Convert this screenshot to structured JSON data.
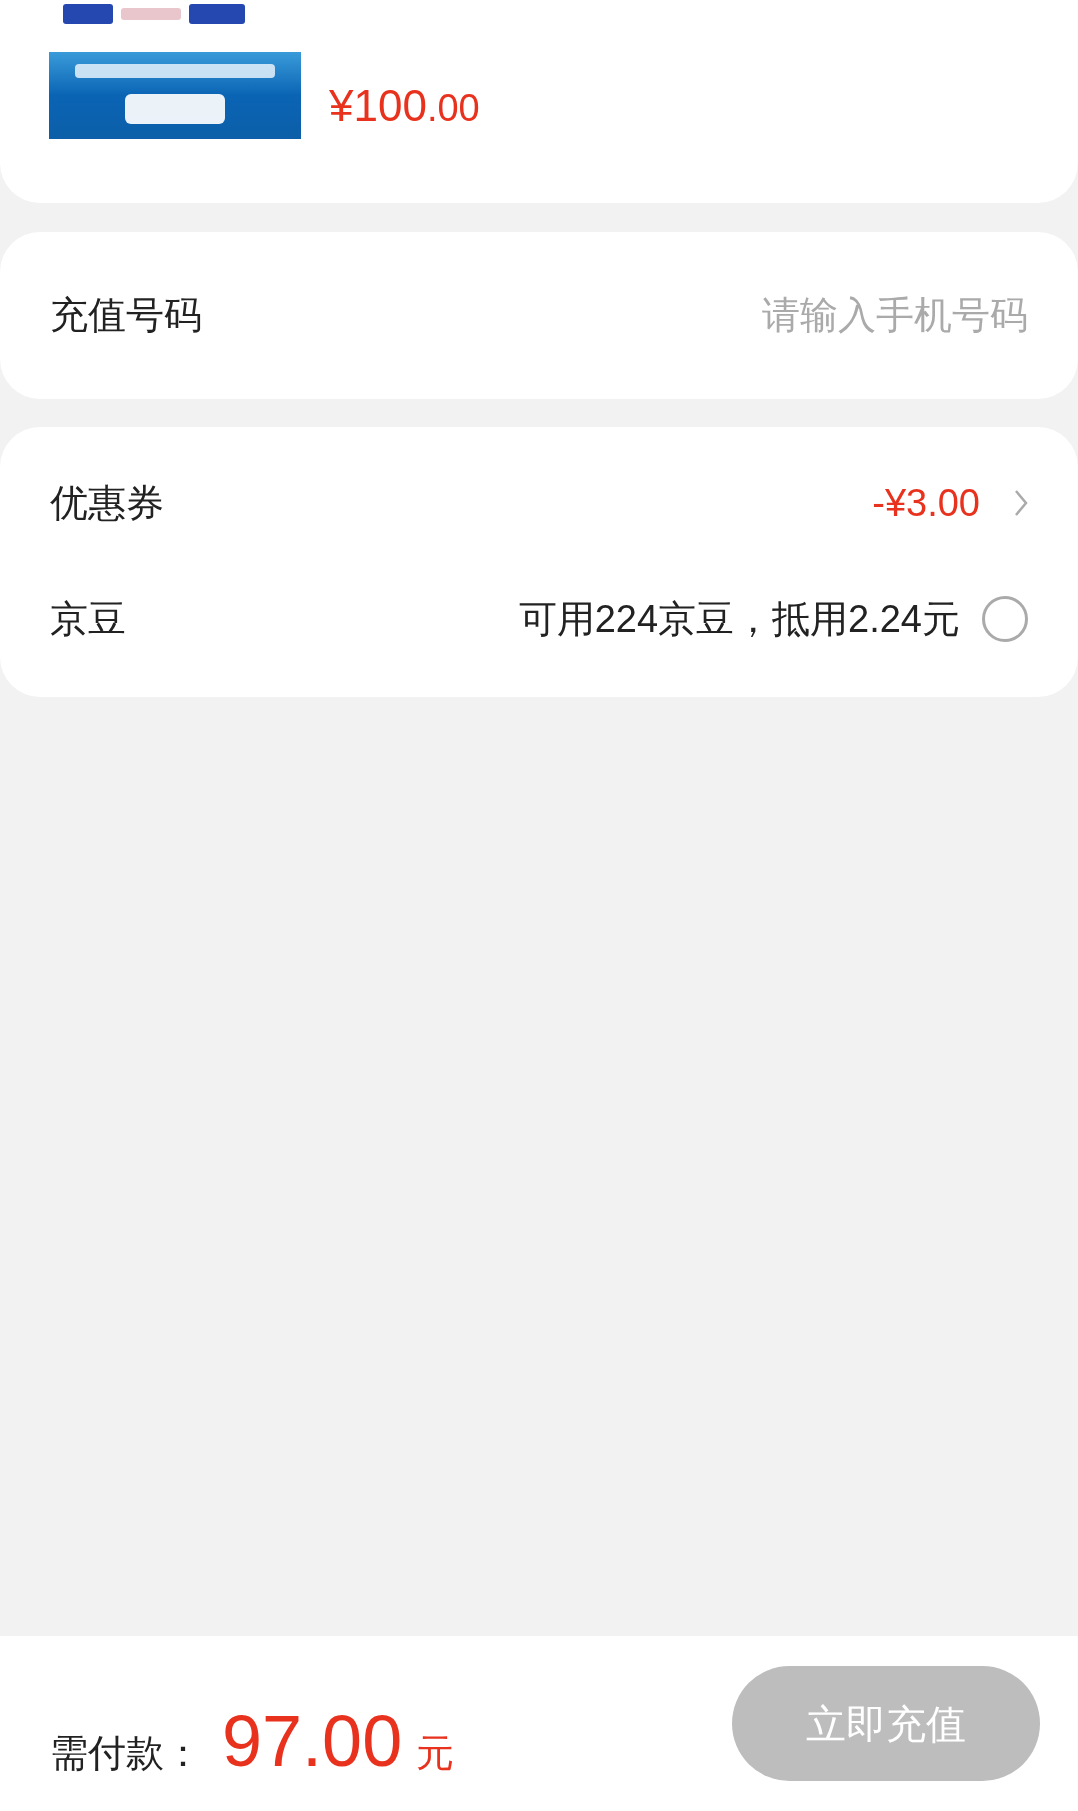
{
  "product": {
    "price": "¥100",
    "price_decimals": ".00"
  },
  "phone": {
    "label": "充值号码",
    "placeholder": "请输入手机号码"
  },
  "coupon": {
    "label": "优惠券",
    "value": "-¥3.00"
  },
  "beans": {
    "label": "京豆",
    "text": "可用224京豆，抵用2.24元",
    "checked": false
  },
  "footer": {
    "label": "需付款：",
    "amount": "97.00",
    "unit": "元",
    "button": "立即充值",
    "button_disabled": true
  }
}
